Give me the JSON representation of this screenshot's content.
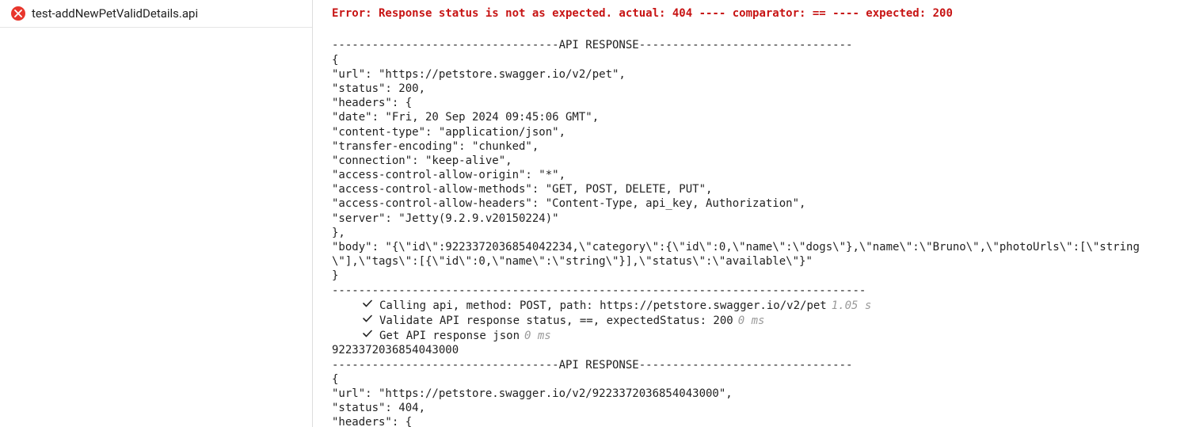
{
  "sidebar": {
    "items": [
      {
        "name": "test-addNewPetValidDetails.api",
        "status": "error"
      }
    ]
  },
  "error_line": "Error: Response status is not as expected. actual: 404 ---- comparator: == ---- expected: 200",
  "blank_line": " ",
  "divider_open": "----------------------------------API RESPONSE--------------------------------",
  "response1": {
    "l01": "{",
    "l02": "\"url\": \"https://petstore.swagger.io/v2/pet\",",
    "l03": "\"status\": 200,",
    "l04": "\"headers\": {",
    "l05": "\"date\": \"Fri, 20 Sep 2024 09:45:06 GMT\",",
    "l06": "\"content-type\": \"application/json\",",
    "l07": "\"transfer-encoding\": \"chunked\",",
    "l08": "\"connection\": \"keep-alive\",",
    "l09": "\"access-control-allow-origin\": \"*\",",
    "l10": "\"access-control-allow-methods\": \"GET, POST, DELETE, PUT\",",
    "l11": "\"access-control-allow-headers\": \"Content-Type, api_key, Authorization\",",
    "l12": "\"server\": \"Jetty(9.2.9.v20150224)\"",
    "l13": "},",
    "l14": "\"body\": \"{\\\"id\\\":9223372036854042234,\\\"category\\\":{\\\"id\\\":0,\\\"name\\\":\\\"dogs\\\"},\\\"name\\\":\\\"Bruno\\\",\\\"photoUrls\\\":[\\\"string\\\"],\\\"tags\\\":[{\\\"id\\\":0,\\\"name\\\":\\\"string\\\"}],\\\"status\\\":\\\"available\\\"}\"",
    "l15": "}"
  },
  "divider_close": "--------------------------------------------------------------------------------",
  "steps": [
    {
      "text": "Calling api, method: POST, path: https://petstore.swagger.io/v2/pet",
      "time": "1.05 s"
    },
    {
      "text": "Validate API response status, ==, expectedStatus: 200",
      "time": "0 ms"
    },
    {
      "text": "Get API response json",
      "time": "0 ms"
    }
  ],
  "id_line": "9223372036854043000",
  "response2": {
    "l01": "{",
    "l02": "\"url\": \"https://petstore.swagger.io/v2/9223372036854043000\",",
    "l03": "\"status\": 404,",
    "l04": "\"headers\": {"
  }
}
